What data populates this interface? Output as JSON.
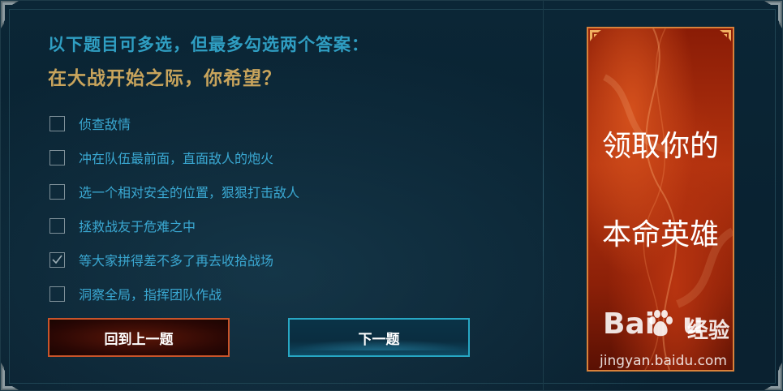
{
  "question": {
    "subtitle": "以下题目可多选，但最多勾选两个答案：",
    "title": "在大战开始之际，你希望？"
  },
  "options": [
    {
      "label": "侦查敌情",
      "checked": false
    },
    {
      "label": "冲在队伍最前面，直面敌人的炮火",
      "checked": false
    },
    {
      "label": "选一个相对安全的位置，狠狠打击敌人",
      "checked": false
    },
    {
      "label": "拯救战友于危难之中",
      "checked": false
    },
    {
      "label": "等大家拼得差不多了再去收拾战场",
      "checked": true
    },
    {
      "label": "洞察全局，指挥团队作战",
      "checked": false
    }
  ],
  "buttons": {
    "prev_label": "回到上一题",
    "next_label": "下一题"
  },
  "banner": {
    "line1": "领取你的",
    "line2": "本命英雄"
  },
  "watermark": {
    "logo_left": "Bai",
    "logo_right": "u",
    "jingyan": "经验",
    "url": "jingyan.baidu.com"
  },
  "colors": {
    "subtitle": "#2f9ec2",
    "title": "#c8a45c",
    "option_text": "#3aa8d2",
    "prev_border": "#c9542a",
    "next_border": "#27a7c4",
    "banner_border": "#d9813a"
  }
}
